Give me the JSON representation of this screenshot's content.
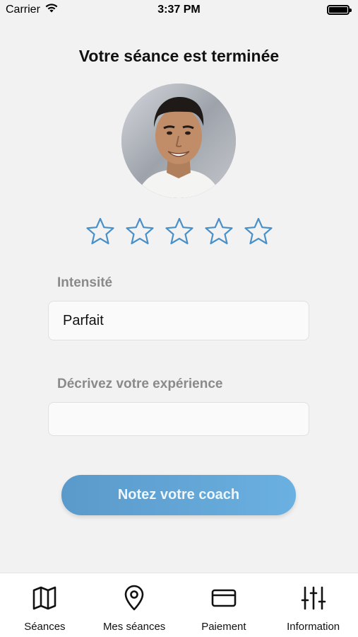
{
  "status_bar": {
    "carrier": "Carrier",
    "time": "3:37 PM",
    "battery_level": 0.92
  },
  "screen": {
    "title": "Votre séance est terminée",
    "rating": {
      "max": 5,
      "value": 0,
      "star_color": "#4a90c8"
    },
    "intensity": {
      "label": "Intensité",
      "value": "Parfait"
    },
    "experience": {
      "label": "Décrivez votre expérience",
      "value": "",
      "placeholder": ""
    },
    "submit_label": "Notez votre coach",
    "accent_color": "#5aa3d6"
  },
  "tab_bar": {
    "items": [
      {
        "label": "Séances",
        "icon": "map-icon"
      },
      {
        "label": "Mes séances",
        "icon": "location-pin-icon"
      },
      {
        "label": "Paiement",
        "icon": "credit-card-icon"
      },
      {
        "label": "Information",
        "icon": "sliders-icon"
      }
    ]
  }
}
